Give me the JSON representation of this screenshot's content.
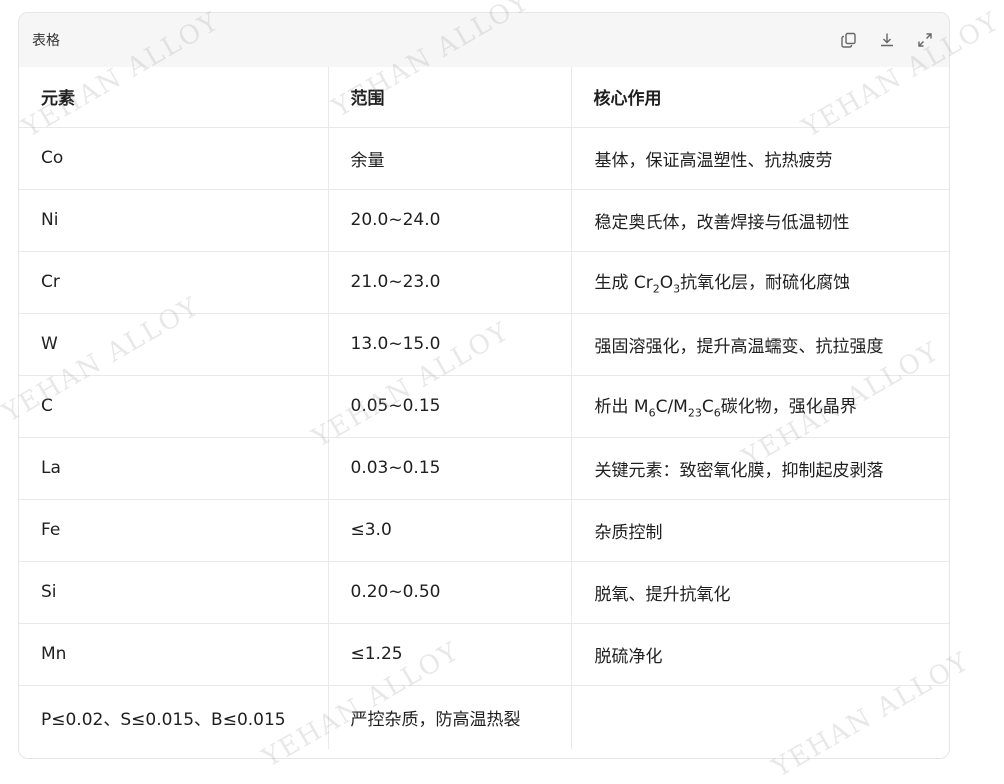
{
  "panel": {
    "title": "表格",
    "icons": [
      "copy-icon",
      "download-icon",
      "expand-icon"
    ]
  },
  "table": {
    "headers": [
      "元素",
      "范围",
      "核心作用"
    ],
    "rows": [
      {
        "element": "Co",
        "range": "余量",
        "effect": "基体，保证高温塑性、抗热疲劳"
      },
      {
        "element": "Ni",
        "range": "20.0~24.0",
        "effect": "稳定奥氏体，改善焊接与低温韧性"
      },
      {
        "element": "Cr",
        "range": "21.0~23.0",
        "effect_pre": "生成 Cr",
        "effect_sub1": "2",
        "effect_mid": "O",
        "effect_sub2": "3",
        "effect_post": "抗氧化层，耐硫化腐蚀"
      },
      {
        "element": "W",
        "range": "13.0~15.0",
        "effect": "强固溶强化，提升高温蠕变、抗拉强度"
      },
      {
        "element": "C",
        "range": "0.05~0.15",
        "effect_pre": "析出 M",
        "effect_sub1": "6",
        "effect_mid": "C/M",
        "effect_sub2": "23",
        "effect_mid2": "C",
        "effect_sub3": "6",
        "effect_post": "碳化物，强化晶界"
      },
      {
        "element": "La",
        "range": "0.03~0.15",
        "effect": "关键元素：致密氧化膜，抑制起皮剥落"
      },
      {
        "element": "Fe",
        "range": "≤3.0",
        "effect": "杂质控制"
      },
      {
        "element": "Si",
        "range": "0.20~0.50",
        "effect": "脱氧、提升抗氧化"
      },
      {
        "element": "Mn",
        "range": "≤1.25",
        "effect": "脱硫净化"
      },
      {
        "element": "P≤0.02、S≤0.015、B≤0.015",
        "range": "严控杂质，防高温热裂",
        "effect": ""
      }
    ]
  },
  "watermark": "YEHAN ALLOY"
}
